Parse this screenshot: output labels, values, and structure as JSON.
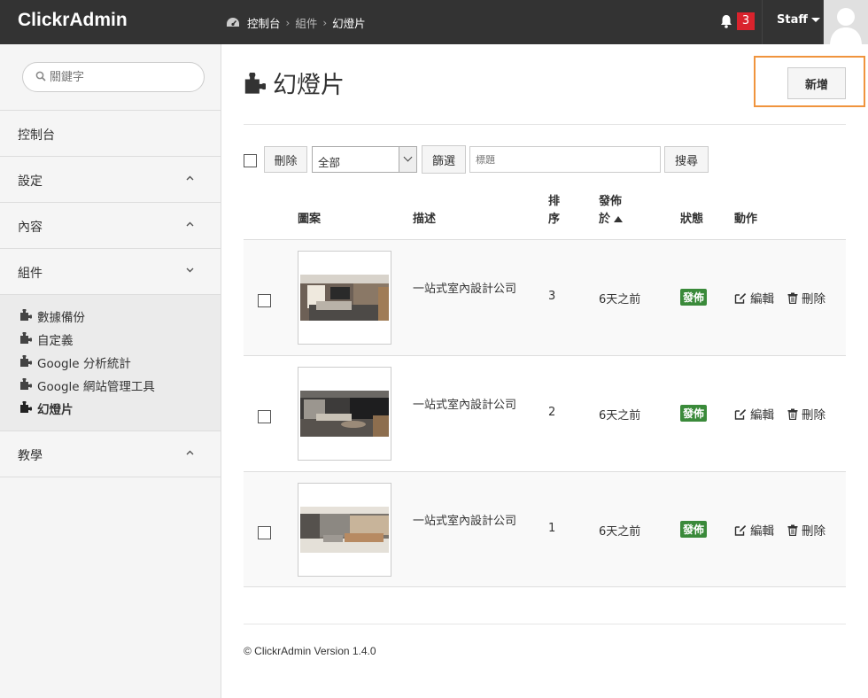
{
  "app": {
    "brand": "ClickrAdmin"
  },
  "breadcrumb": [
    "控制台",
    "組件",
    "幻燈片"
  ],
  "header": {
    "notifications": "3",
    "user": "Staff"
  },
  "sidebar": {
    "search_placeholder": "關鍵字",
    "items": [
      {
        "label": "控制台"
      },
      {
        "label": "設定"
      },
      {
        "label": "內容"
      },
      {
        "label": "組件"
      }
    ],
    "sub_items": [
      {
        "label": "數據備份"
      },
      {
        "label": "自定義"
      },
      {
        "label": "Google 分析統計"
      },
      {
        "label": "Google 網站管理工具"
      },
      {
        "label": "幻燈片"
      }
    ],
    "last_item": {
      "label": "教學"
    }
  },
  "page": {
    "title": "幻燈片",
    "add_label": "新增"
  },
  "toolbar": {
    "delete_label": "刪除",
    "filter_value": "全部",
    "filter_label": "篩選",
    "search_placeholder": "標題",
    "search_label": "搜尋"
  },
  "table": {
    "headers": {
      "image": "圖案",
      "desc": "描述",
      "order_l1": "排",
      "order_l2": "序",
      "pub_l1": "發佈",
      "pub_l2": "於",
      "status": "狀態",
      "action": "動作"
    },
    "rows": [
      {
        "desc": "一站式室內設計公司",
        "order": "3",
        "published": "6天之前",
        "status": "發佈",
        "edit": "編輯",
        "delete": "刪除"
      },
      {
        "desc": "一站式室內設計公司",
        "order": "2",
        "published": "6天之前",
        "status": "發佈",
        "edit": "編輯",
        "delete": "刪除"
      },
      {
        "desc": "一站式室內設計公司",
        "order": "1",
        "published": "6天之前",
        "status": "發佈",
        "edit": "編輯",
        "delete": "刪除"
      }
    ]
  },
  "footer": {
    "text": "© ClickrAdmin Version 1.4.0"
  },
  "colors": {
    "topbar": "#333333",
    "badge": "#d9232d",
    "status": "#3a8a3a",
    "highlight": "#f0943d"
  }
}
